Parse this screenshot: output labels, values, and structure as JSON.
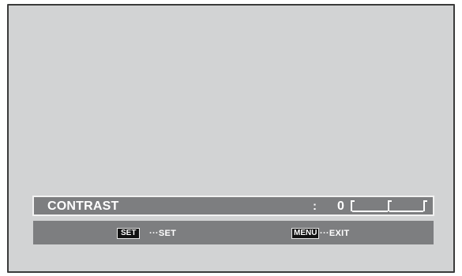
{
  "osd": {
    "item_label": "CONTRAST",
    "separator": ":",
    "value": "0",
    "level_fraction": 0.5
  },
  "help": {
    "set_key": "SET",
    "set_action": "···SET",
    "menu_key": "MENU",
    "menu_action": "···EXIT"
  },
  "colors": {
    "screen_bg": "#d2d3d4",
    "osd_bg": "#7d7e80",
    "text": "#ffffff",
    "key_bg": "#111111"
  }
}
